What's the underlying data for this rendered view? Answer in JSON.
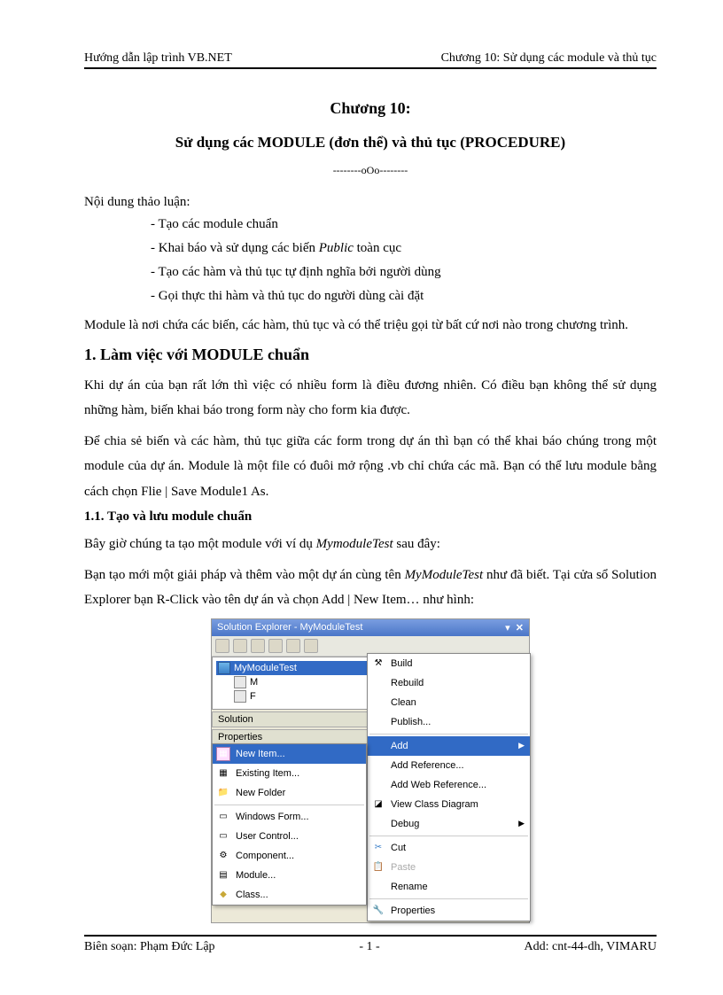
{
  "header": {
    "left": "Hướng dẫn lập trình  VB.NET",
    "right": "Chương 10: Sử dụng các module  và thủ tục"
  },
  "chapter": {
    "title": "Chương 10:",
    "subtitle": "Sử dụng các MODULE (đơn thể) và thủ tục (PROCEDURE)",
    "divider": "--------oOo--------"
  },
  "intro_label": "Nội dung thảo luận:",
  "bullets": [
    "- Tạo các module  chuẩn",
    "- Khai báo và sử dụng các biến Public toàn cục",
    "- Tạo các hàm và thủ tục tự định nghĩa bởi người  dùng",
    "- Gọi thực thi hàm và thủ tục do người dùng cài đặt"
  ],
  "para1": "Module là nơi chứa các biến, các hàm, thủ tục và có thể triệu gọi từ bất cứ nơi nào trong chương trình.",
  "h1": "1. Làm việc với MODULE chuẩn",
  "para2": "Khi dự án của bạn rất lớn thì việc có nhiều form là điều đương nhiên. Có điều bạn không thể sử dụng những hàm, biến khai báo trong form này cho form kia được.",
  "para3": "Để chia sẻ biến và các hàm, thủ tục giữa các form trong dự án thì bạn có thể khai báo chúng trong một module của dự án. Module là một file có đuôi mở rộng .vb chỉ chứa các mã. Bạn có thể lưu module bằng cách chọn Flie | Save Module1 As.",
  "h2": "1.1. Tạo và lưu module  chuẩn",
  "para4_prefix": "Bây giờ chúng ta tạo một module với ví dụ ",
  "para4_italic": "MymoduleTest",
  "para4_suffix": " sau đây:",
  "para5_prefix": "Bạn tạo mới một giải pháp và thêm vào một dự án cùng tên ",
  "para5_italic": "MyModuleTest",
  "para5_suffix": " như đã biết. Tại cửa sổ Solution  Explorer bạn R-Click vào tên dự án và chọn Add | New Item… như hình:",
  "vs_ui": {
    "window_title": "Solution Explorer - MyModuleTest",
    "pin": "▾",
    "close": "✕",
    "tree": {
      "project": "MyModuleTest",
      "node1": "M",
      "node2": "F"
    },
    "solution_bar": "Solution",
    "properties_bar": "Properties",
    "menu_right": [
      {
        "label": "Build",
        "icon": "⚙"
      },
      {
        "label": "Rebuild",
        "icon": ""
      },
      {
        "label": "Clean",
        "icon": ""
      },
      {
        "label": "Publish...",
        "icon": ""
      },
      {
        "sep": true
      },
      {
        "label": "Add",
        "icon": "",
        "highlight": true,
        "arrow": "▶"
      },
      {
        "label": "Add Reference...",
        "icon": ""
      },
      {
        "label": "Add Web Reference...",
        "icon": ""
      },
      {
        "label": "View Class Diagram",
        "icon": "◪"
      },
      {
        "label": "Debug",
        "icon": "",
        "arrow": "▶"
      },
      {
        "sep": true
      },
      {
        "label": "Cut",
        "icon": "✂"
      },
      {
        "label": "Paste",
        "icon": "📋",
        "disabled": true
      },
      {
        "label": "Rename",
        "icon": ""
      },
      {
        "sep": true
      },
      {
        "label": "Properties",
        "icon": "🔧"
      }
    ],
    "menu_left": [
      {
        "label": "New Item...",
        "icon": "▦",
        "highlight": true
      },
      {
        "label": "Existing Item...",
        "icon": "▦"
      },
      {
        "label": "New Folder",
        "icon": "📁"
      },
      {
        "sep": true
      },
      {
        "label": "Windows Form...",
        "icon": "▭"
      },
      {
        "label": "User Control...",
        "icon": "▭"
      },
      {
        "label": "Component...",
        "icon": "⚙"
      },
      {
        "label": "Module...",
        "icon": "▤"
      },
      {
        "label": "Class...",
        "icon": "◆"
      }
    ]
  },
  "footer": {
    "left": "Biên soạn: Phạm Đức Lập",
    "center": "- 1 -",
    "right": "Add: cnt-44-dh, VIMARU"
  }
}
